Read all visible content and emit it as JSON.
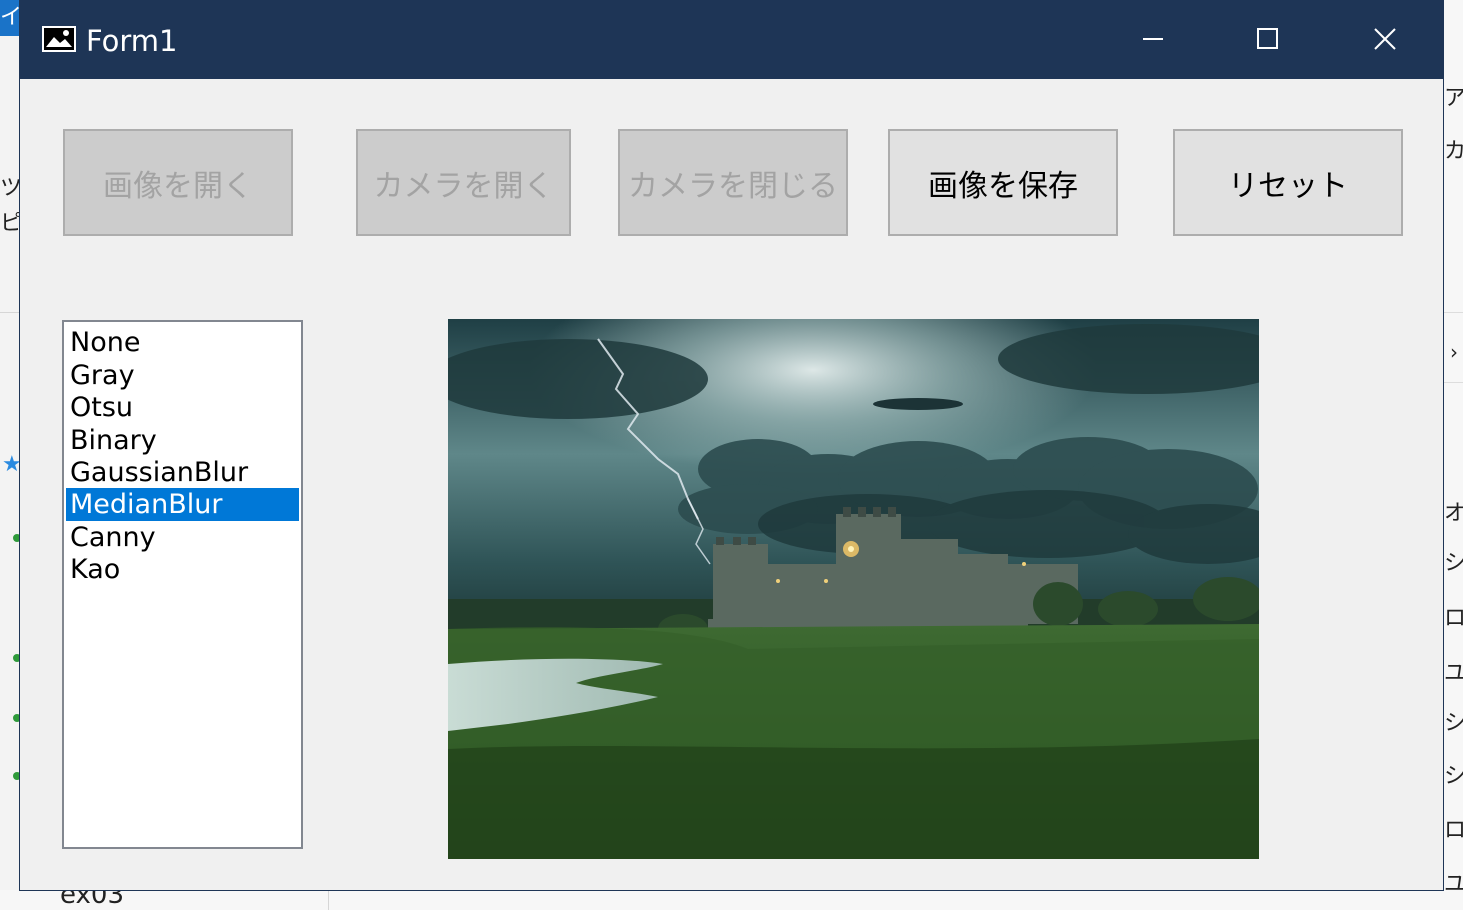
{
  "window": {
    "title": "Form1",
    "controls": {
      "minimize": "minimize-icon",
      "maximize": "maximize-icon",
      "close": "close-icon"
    }
  },
  "buttons": [
    {
      "label": "画像を開く",
      "enabled": false
    },
    {
      "label": "カメラを開く",
      "enabled": false
    },
    {
      "label": "カメラを閉じる",
      "enabled": false
    },
    {
      "label": "画像を保存",
      "enabled": true
    },
    {
      "label": "リセット",
      "enabled": true
    }
  ],
  "filter_list": {
    "items": [
      "None",
      "Gray",
      "Otsu",
      "Binary",
      "GaussianBlur",
      "MedianBlur",
      "Canny",
      "Kao"
    ],
    "selected": "MedianBlur"
  },
  "picture": {
    "description_icon": "castle-landscape-image"
  },
  "background": {
    "left_top_glyph": "イ",
    "left_glyphs": [
      "ツ",
      "ピ"
    ],
    "right_glyphs": [
      "ア",
      "カ",
      "オ",
      "シ",
      "ロ",
      "ユ",
      "シ",
      "シ",
      "ロ",
      "ユ"
    ],
    "bottom_text": "ex03"
  },
  "colors": {
    "titlebar": "#1e3556",
    "selection": "#0078d7",
    "form_bg": "#f0f0f0"
  }
}
